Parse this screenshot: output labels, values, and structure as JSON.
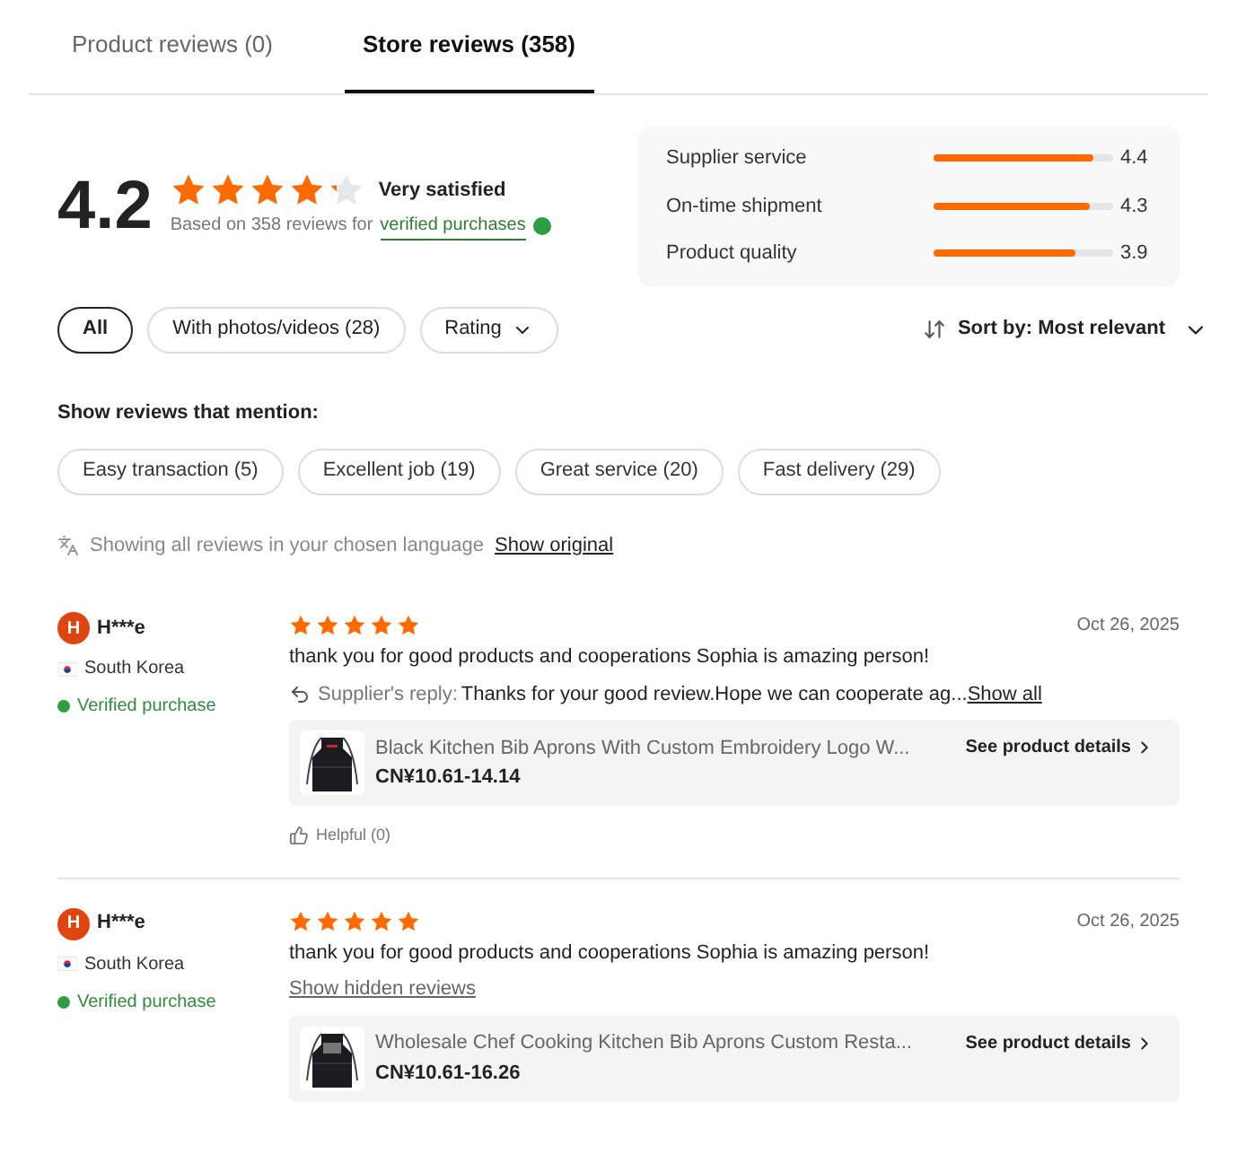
{
  "tabs": [
    {
      "label": "Product reviews (0)",
      "selected": false
    },
    {
      "label": "Store reviews (358)",
      "selected": true
    }
  ],
  "summary": {
    "score": "4.2",
    "stars": 4.2,
    "verdict": "Very satisfied",
    "based_on": "Based on 358 reviews for",
    "verified_link": "verified purchases"
  },
  "ratings": [
    {
      "label": "Supplier service",
      "level": 0.89,
      "value": "4.4"
    },
    {
      "label": "On-time shipment",
      "level": 0.87,
      "value": "4.3"
    },
    {
      "label": "Product quality",
      "level": 0.79,
      "value": "3.9"
    }
  ],
  "filters": [
    {
      "label": "All",
      "selected": true,
      "dropdown": false
    },
    {
      "label": "With photos/videos (28)",
      "selected": false,
      "dropdown": false
    },
    {
      "label": "Rating",
      "selected": false,
      "dropdown": true
    }
  ],
  "sort": {
    "label": "Sort by: Most relevant"
  },
  "mentions": {
    "title": "Show reviews that mention:",
    "tags": [
      "Easy transaction (5)",
      "Excellent job (19)",
      "Great service (20)",
      "Fast delivery (29)"
    ]
  },
  "language_note": {
    "text": "Showing all reviews in your chosen language",
    "link": "Show original"
  },
  "reviews": [
    {
      "initial": "H",
      "name": "H***e",
      "country": "South Korea",
      "verified": "Verified purchase",
      "stars": 5,
      "date": "Oct 26, 2025",
      "text": "thank you for good products and cooperations Sophia is amazing person!",
      "reply_label": "Supplier's reply:",
      "reply": "Thanks for your good review.Hope we can cooperate ag...",
      "reply_link": "Show all",
      "product": {
        "kind": "picture",
        "title": "Black Kitchen Bib Aprons With Custom Embroidery Logo W...",
        "price": "CN¥10.61-14.14",
        "details": "See product details"
      },
      "helpful": "Helpful (0)"
    },
    {
      "initial": "H",
      "name": "H***e",
      "country": "South Korea",
      "verified": "Verified purchase",
      "stars": 5,
      "date": "Oct 26, 2025",
      "text": "thank you for good products and cooperations Sophia is amazing person!",
      "hidden_link": "Show hidden reviews",
      "product": {
        "kind": "picture",
        "title": "Wholesale Chef Cooking Kitchen Bib Aprons Custom Resta...",
        "price": "CN¥10.61-16.26",
        "details": "See product details"
      }
    }
  ]
}
